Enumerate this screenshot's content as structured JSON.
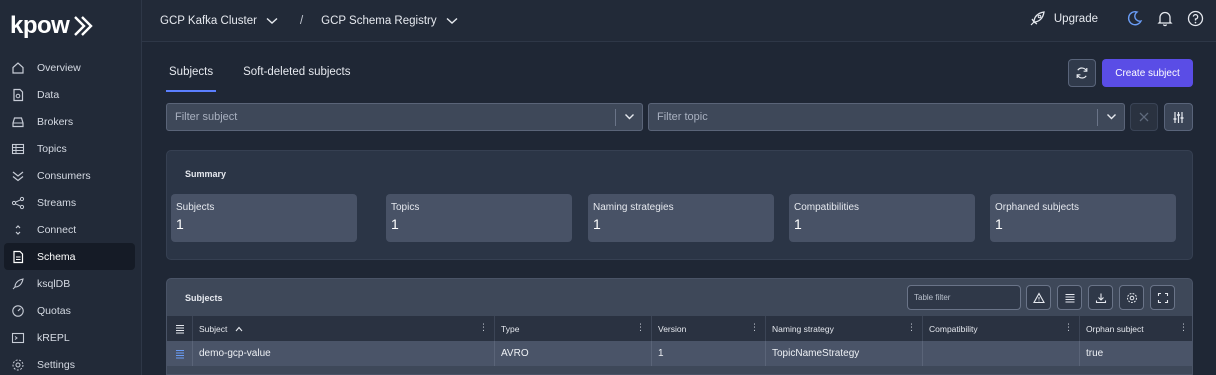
{
  "app": {
    "logo_text": "kpow"
  },
  "sidebar": {
    "items": [
      {
        "label": "Overview",
        "icon": "home-icon"
      },
      {
        "label": "Data",
        "icon": "document-search-icon"
      },
      {
        "label": "Brokers",
        "icon": "server-icon"
      },
      {
        "label": "Topics",
        "icon": "table-icon"
      },
      {
        "label": "Consumers",
        "icon": "chevrons-down-icon"
      },
      {
        "label": "Streams",
        "icon": "share-icon"
      },
      {
        "label": "Connect",
        "icon": "connect-icon"
      },
      {
        "label": "Schema",
        "icon": "file-icon",
        "active": true
      },
      {
        "label": "ksqlDB",
        "icon": "rocket-icon"
      },
      {
        "label": "Quotas",
        "icon": "gauge-icon"
      },
      {
        "label": "kREPL",
        "icon": "terminal-icon"
      },
      {
        "label": "Settings",
        "icon": "gear-icon"
      }
    ]
  },
  "topbar": {
    "cluster": "GCP Kafka Cluster",
    "separator": "/",
    "registry": "GCP Schema Registry",
    "upgrade": "Upgrade"
  },
  "tabs": [
    {
      "label": "Subjects",
      "active": true
    },
    {
      "label": "Soft-deleted subjects"
    }
  ],
  "actions": {
    "create_subject": "Create subject"
  },
  "filters": {
    "subject_placeholder": "Filter subject",
    "topic_placeholder": "Filter topic"
  },
  "summary": {
    "title": "Summary",
    "cards": [
      {
        "label": "Subjects",
        "value": "1"
      },
      {
        "label": "Topics",
        "value": "1"
      },
      {
        "label": "Naming strategies",
        "value": "1"
      },
      {
        "label": "Compatibilities",
        "value": "1"
      },
      {
        "label": "Orphaned subjects",
        "value": "1"
      }
    ]
  },
  "table": {
    "title": "Subjects",
    "filter_placeholder": "Table filter",
    "columns": [
      "Subject",
      "Type",
      "Version",
      "Naming strategy",
      "Compatibility",
      "Orphan subject"
    ],
    "rows": [
      {
        "subject": "demo-gcp-value",
        "type": "AVRO",
        "version": "1",
        "naming_strategy": "TopicNameStrategy",
        "compatibility": "",
        "orphan": "true"
      }
    ]
  },
  "colors": {
    "accent": "#5a4de6",
    "tab_underline": "#5b7fff",
    "moon": "#6a9cf5"
  }
}
